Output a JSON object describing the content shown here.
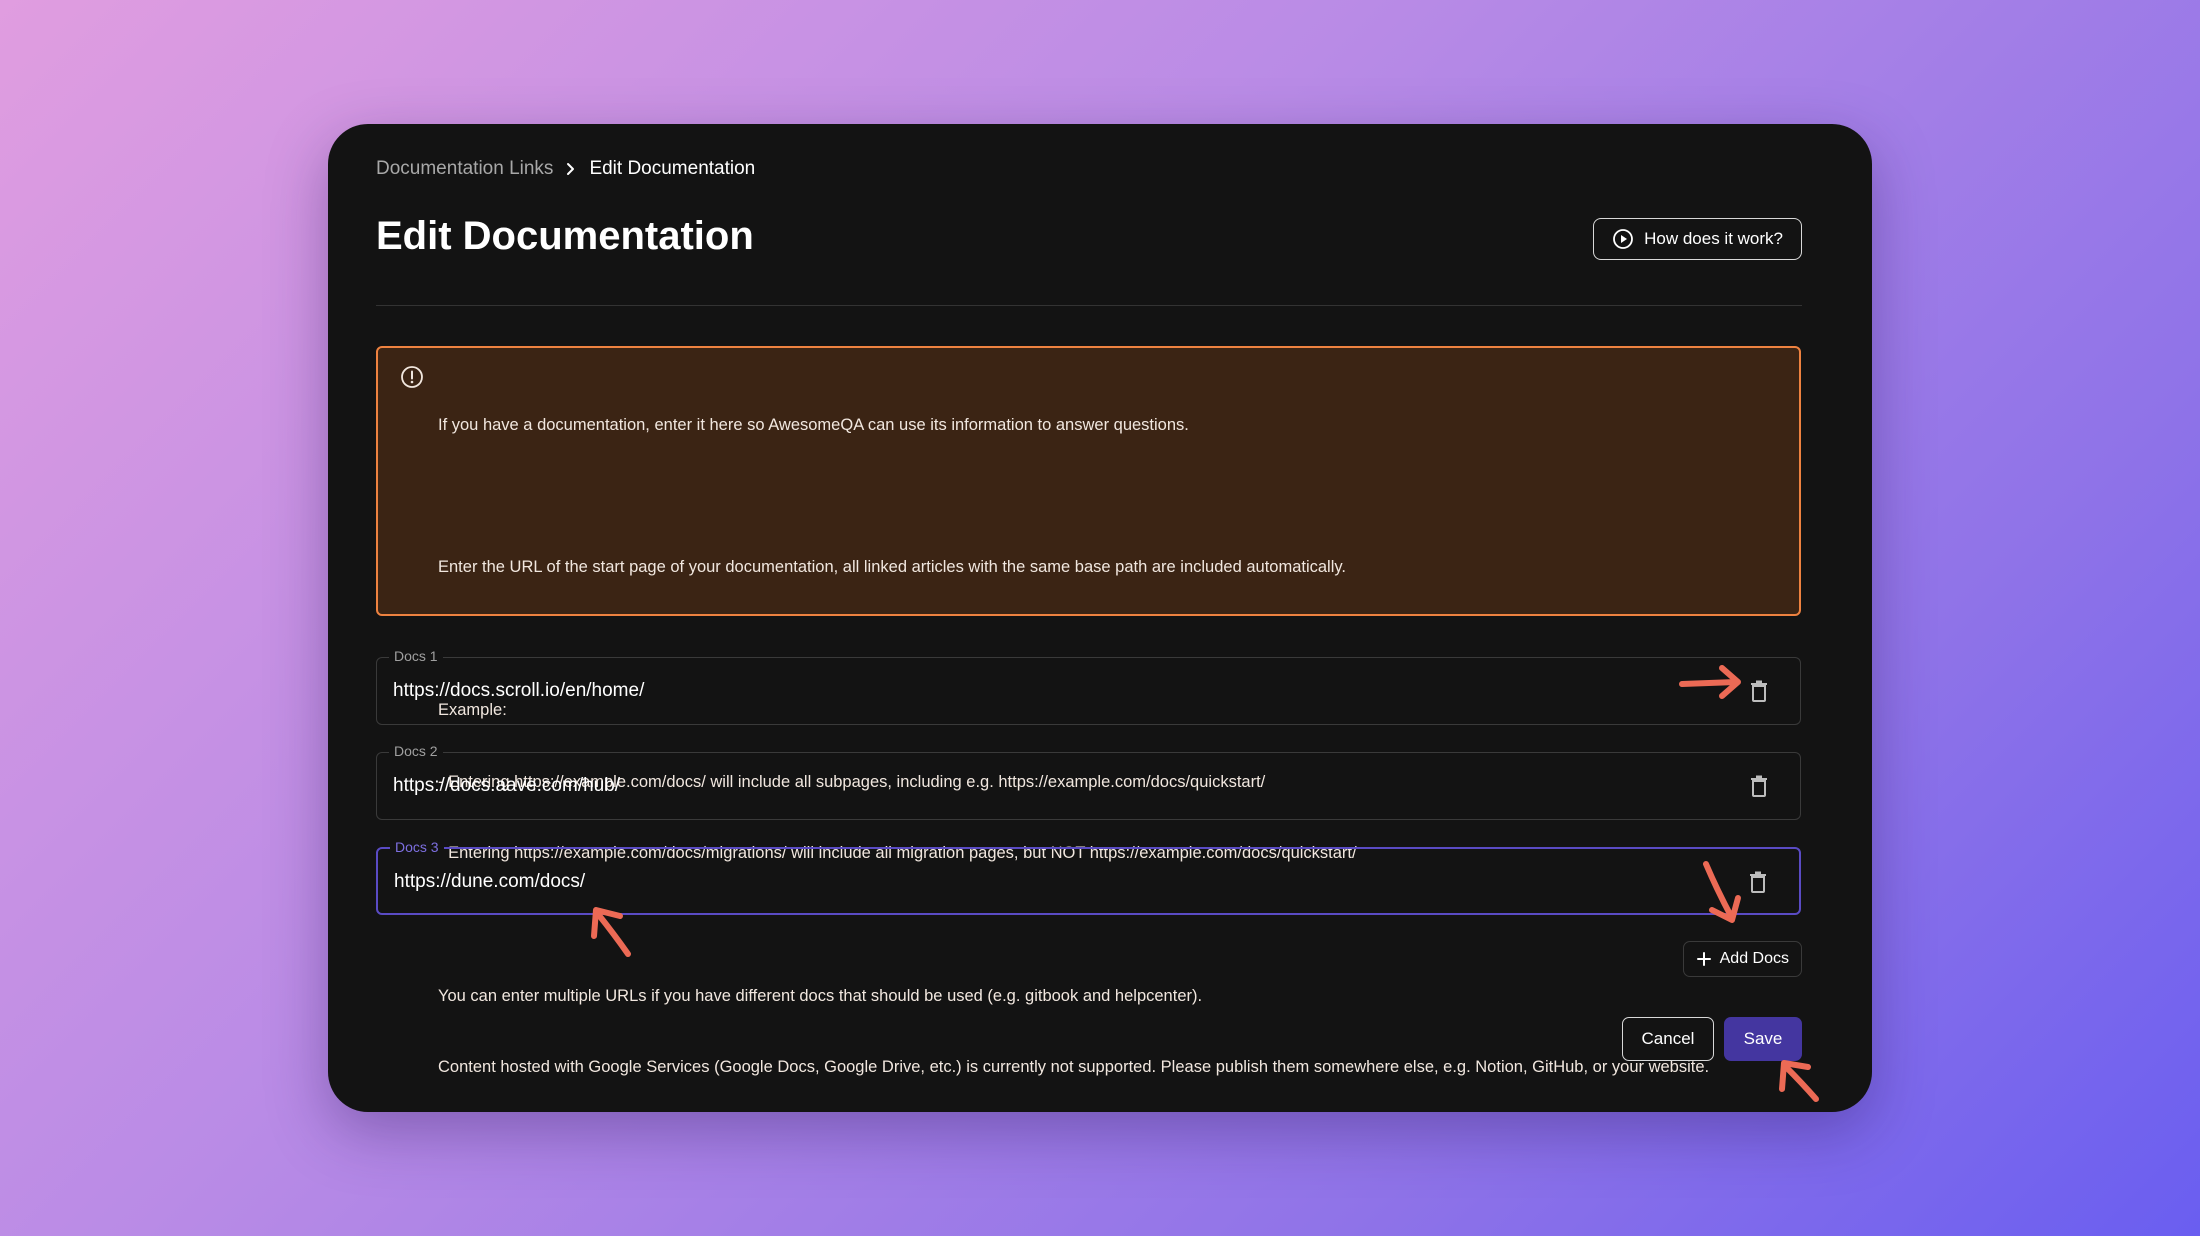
{
  "breadcrumb": {
    "parent": "Documentation Links",
    "current": "Edit Documentation"
  },
  "page_title": "Edit Documentation",
  "help_button": {
    "label": "How does it work?",
    "icon": "play-circle-icon"
  },
  "alert": {
    "icon": "info-circle-icon",
    "color": "#ee8240",
    "lines": [
      "If you have a documentation, enter it here so AwesomeQA can use its information to answer questions.",
      "",
      "Enter the URL of the start page of your documentation, all linked articles with the same base path are included automatically.",
      "",
      "Example:",
      "- Entering https://example.com/docs/ will include all subpages, including e.g. https://example.com/docs/quickstart/",
      "- Entering https://example.com/docs/migrations/ will include all migration pages, but NOT https://example.com/docs/quickstart/",
      "",
      "You can enter multiple URLs if you have different docs that should be used (e.g. gitbook and helpcenter).",
      "Content hosted with Google Services (Google Docs, Google Drive, etc.) is currently not supported. Please publish them somewhere else, e.g. Notion, GitHub, or your website."
    ]
  },
  "docs": [
    {
      "label": "Docs 1",
      "value": "https://docs.scroll.io/en/home/"
    },
    {
      "label": "Docs 2",
      "value": "https://docs.aave.com/hub/"
    },
    {
      "label": "Docs 3",
      "value": "https://dune.com/docs/"
    }
  ],
  "add_button": {
    "label": "Add Docs",
    "icon": "plus-icon"
  },
  "cancel_button": {
    "label": "Cancel"
  },
  "save_button": {
    "label": "Save"
  },
  "colors": {
    "accent": "#4436a0",
    "focus_border": "#5a4bc4",
    "annotation_arrow": "#ec6a55"
  }
}
